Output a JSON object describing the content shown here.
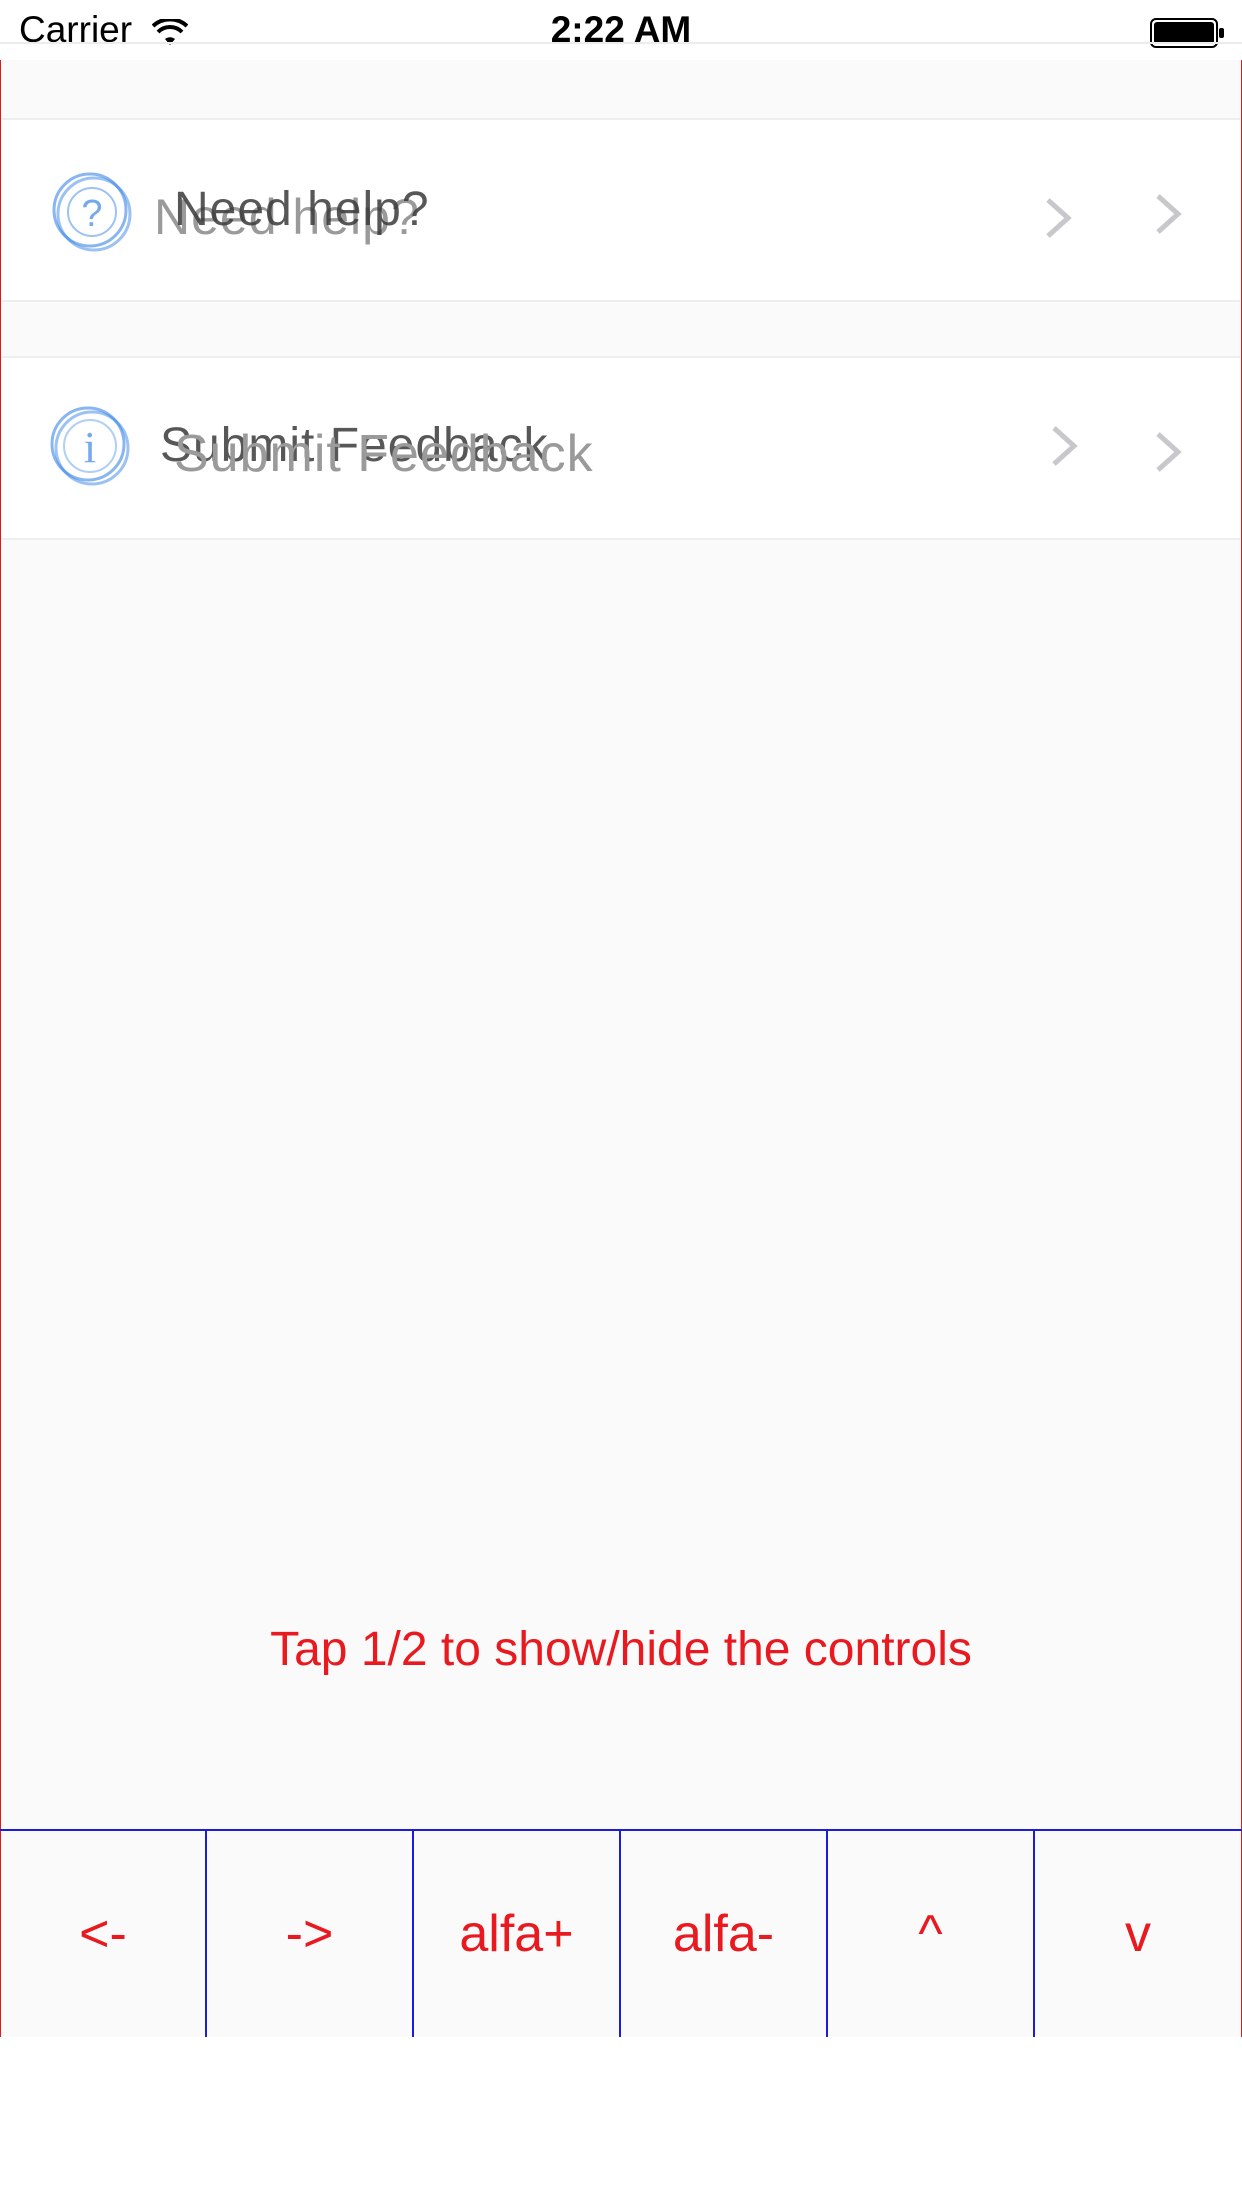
{
  "status_bar": {
    "carrier": "Carrier",
    "time": "2:22 AM"
  },
  "rows": [
    {
      "label": "Need help?",
      "icon": "question-circle-icon"
    },
    {
      "label": "Submit Feedback",
      "icon": "info-circle-icon"
    }
  ],
  "hint": "Tap 1/2 to show/hide the controls",
  "controls": {
    "left": "<-",
    "right": "->",
    "alfa_plus": "alfa+",
    "alfa_minus": "alfa-",
    "up": "^",
    "down": "v"
  },
  "colors": {
    "overlay_border": "#e0191c",
    "control_text": "#e8191f",
    "control_border": "#1b1bd8",
    "icon_blue": "#3a86e8"
  }
}
